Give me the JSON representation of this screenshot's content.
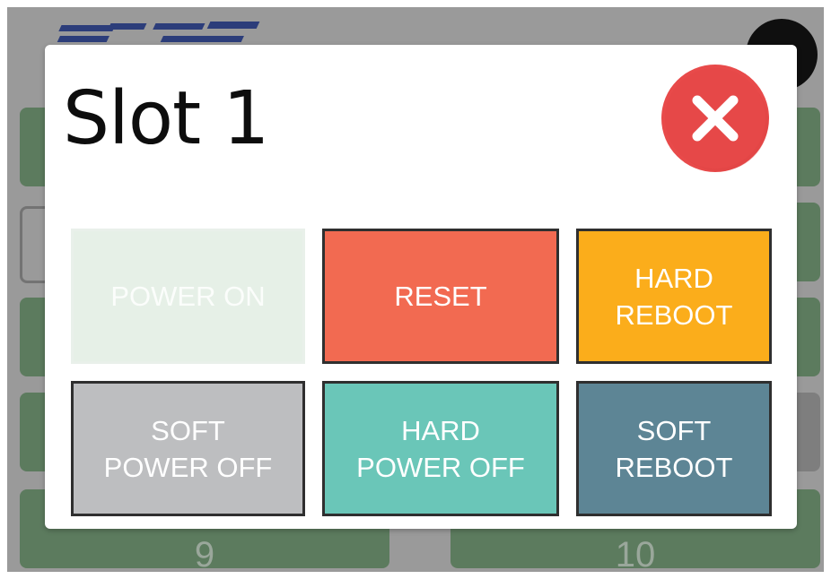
{
  "background": {
    "slot_tiles": [
      {
        "label": "9"
      },
      {
        "label": "10"
      }
    ]
  },
  "modal": {
    "title": "Slot 1",
    "close_icon": "close-icon",
    "buttons": [
      {
        "label": "POWER ON",
        "color": "#e6f0e7",
        "disabled": true
      },
      {
        "label": "RESET",
        "color": "#f26a51",
        "disabled": false
      },
      {
        "label": "HARD\nREBOOT",
        "color": "#fbad1b",
        "disabled": false
      },
      {
        "label": "SOFT\nPOWER OFF",
        "color": "#bdbec0",
        "disabled": false
      },
      {
        "label": "HARD\nPOWER OFF",
        "color": "#6ac6b8",
        "disabled": false
      },
      {
        "label": "SOFT\nREBOOT",
        "color": "#5d8595",
        "disabled": false
      }
    ]
  },
  "colors": {
    "overlay": "#9a9a9a",
    "tile_green": "#5c7b5e",
    "close_red": "#e84a4a"
  }
}
